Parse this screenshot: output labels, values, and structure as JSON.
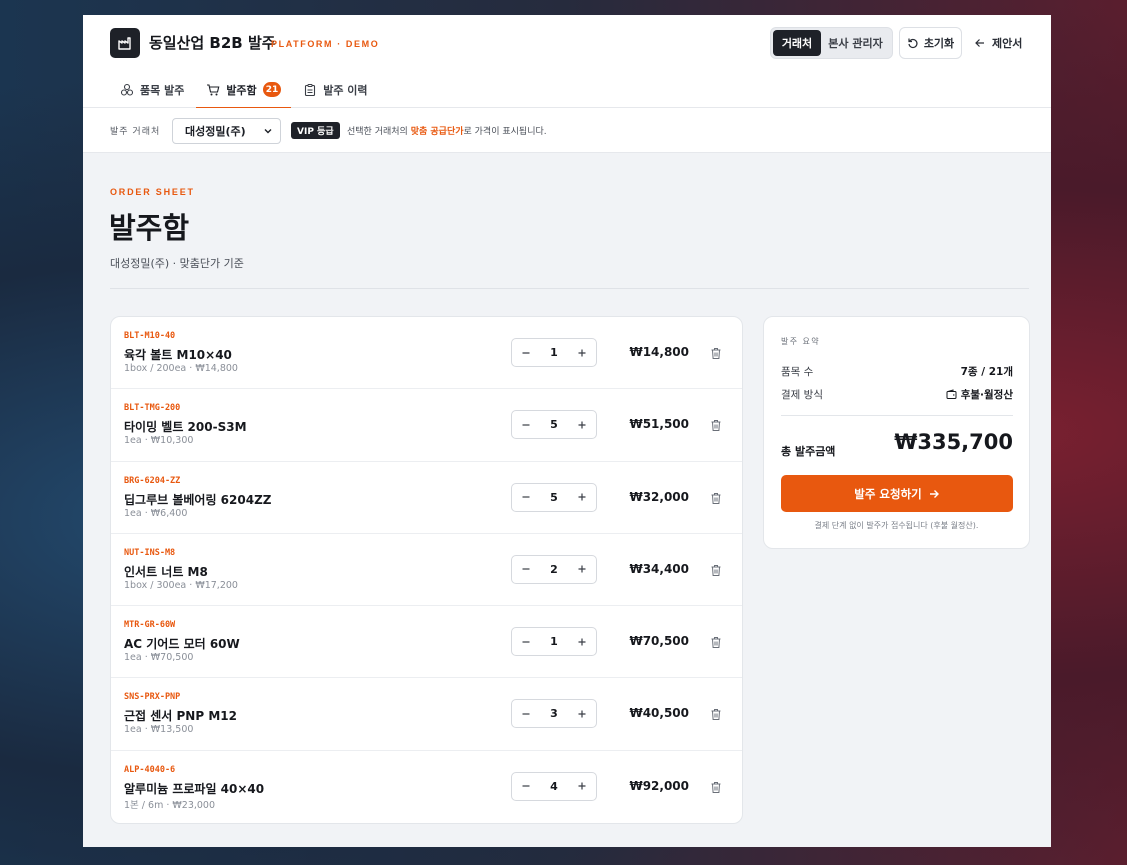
{
  "header": {
    "brand": "동일산업 B2B 발주",
    "brand_sub": "PLATFORM · DEMO",
    "segment": {
      "active": "거래처",
      "other": "본사 관리자"
    },
    "reset_label": "초기화",
    "proposal_label": "제안서"
  },
  "tabs": [
    {
      "label": "품목 발주"
    },
    {
      "label": "발주함",
      "badge": "21"
    },
    {
      "label": "발주 이력"
    }
  ],
  "vendor_bar": {
    "label": "발주 거래처",
    "selected": "대성정밀(주)",
    "vip": "VIP 등급",
    "note_prefix": "선택한 거래처의 ",
    "note_highlight": "맞춤 공급단가",
    "note_suffix": "로 가격이 표시됩니다."
  },
  "main": {
    "eyebrow": "ORDER SHEET",
    "title": "발주함",
    "subtitle": "대성정밀(주) · 맞춤단가 기준"
  },
  "items": [
    {
      "sku": "BLT-M10-40",
      "name": "육각 볼트 M10×40",
      "meta": "1box / 200ea · ₩14,800",
      "qty": "1",
      "price": "₩14,800"
    },
    {
      "sku": "BLT-TMG-200",
      "name": "타이밍 벨트 200-S3M",
      "meta": "1ea · ₩10,300",
      "qty": "5",
      "price": "₩51,500"
    },
    {
      "sku": "BRG-6204-ZZ",
      "name": "딥그루브 볼베어링 6204ZZ",
      "meta": "1ea · ₩6,400",
      "qty": "5",
      "price": "₩32,000"
    },
    {
      "sku": "NUT-INS-M8",
      "name": "인서트 너트 M8",
      "meta": "1box / 300ea · ₩17,200",
      "qty": "2",
      "price": "₩34,400"
    },
    {
      "sku": "MTR-GR-60W",
      "name": "AC 기어드 모터 60W",
      "meta": "1ea · ₩70,500",
      "qty": "1",
      "price": "₩70,500"
    },
    {
      "sku": "SNS-PRX-PNP",
      "name": "근접 센서 PNP M12",
      "meta": "1ea · ₩13,500",
      "qty": "3",
      "price": "₩40,500"
    },
    {
      "sku": "ALP-4040-6",
      "name": "알루미늄 프로파일 40×40",
      "meta": "1본 / 6m · ₩23,000",
      "qty": "4",
      "price": "₩92,000"
    }
  ],
  "summary": {
    "label": "발주 요약",
    "count_label": "품목 수",
    "count_value": "7종 / 21개",
    "payment_label": "결제 방식",
    "payment_value": "후불·월정산",
    "total_label": "총 발주금액",
    "total_value": "₩335,700",
    "cta": "발주 요청하기",
    "note": "결제 단계 없이 발주가 접수됩니다 (후불 월정산)."
  },
  "colors": {
    "accent": "#e8580f",
    "dark": "#1e2128"
  }
}
